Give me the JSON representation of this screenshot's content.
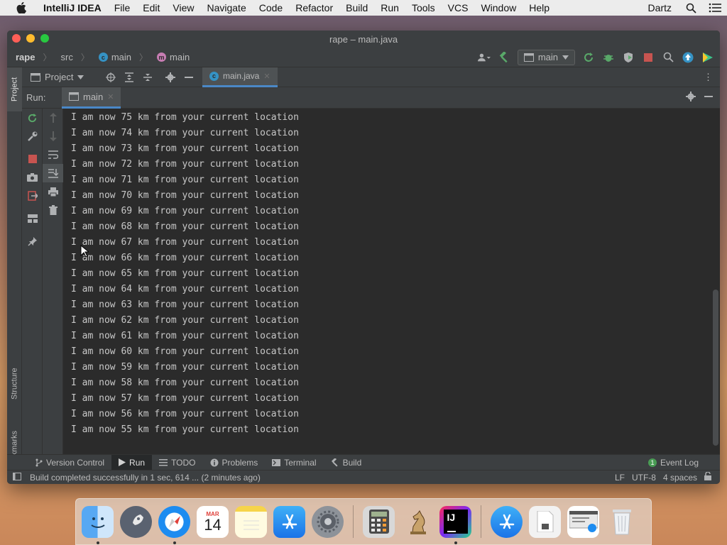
{
  "menubar": {
    "app_name": "IntelliJ IDEA",
    "items": [
      "File",
      "Edit",
      "View",
      "Navigate",
      "Code",
      "Refactor",
      "Build",
      "Run",
      "Tools",
      "VCS",
      "Window",
      "Help"
    ],
    "right_label": "Dartz"
  },
  "window": {
    "title": "rape – main.java"
  },
  "navbar": {
    "crumbs": [
      "rape",
      "src",
      "main",
      "main"
    ],
    "run_config": "main"
  },
  "project_toolbar": {
    "label": "Project",
    "editor_tab": "main.java"
  },
  "run_panel": {
    "title": "Run:",
    "tab": "main"
  },
  "left_strip": {
    "project": "Project",
    "structure": "Structure",
    "bookmarks": "Bookmarks"
  },
  "console": {
    "lines": [
      "I am now 75 km from your current location",
      "I am now 74 km from your current location",
      "I am now 73 km from your current location",
      "I am now 72 km from your current location",
      "I am now 71 km from your current location",
      "I am now 70 km from your current location",
      "I am now 69 km from your current location",
      "I am now 68 km from your current location",
      "I am now 67 km from your current location",
      "I am now 66 km from your current location",
      "I am now 65 km from your current location",
      "I am now 64 km from your current location",
      "I am now 63 km from your current location",
      "I am now 62 km from your current location",
      "I am now 61 km from your current location",
      "I am now 60 km from your current location",
      "I am now 59 km from your current location",
      "I am now 58 km from your current location",
      "I am now 57 km from your current location",
      "I am now 56 km from your current location",
      "I am now 55 km from your current location"
    ]
  },
  "bottom_tabs": {
    "version_control": "Version Control",
    "run": "Run",
    "todo": "TODO",
    "problems": "Problems",
    "terminal": "Terminal",
    "build": "Build",
    "event_log": "Event Log",
    "event_count": "1"
  },
  "statusbar": {
    "message": "Build completed successfully in 1 sec, 614 ... (2 minutes ago)",
    "line_sep": "LF",
    "encoding": "UTF-8",
    "indent": "4 spaces"
  },
  "dock": {
    "calendar_month": "MAR",
    "calendar_day": "14",
    "intellij_label": "IJ"
  },
  "colors": {
    "accent": "#4a88c7",
    "editor_bg": "#2b2b2b",
    "panel_bg": "#3c3f41",
    "run_green": "#499c54",
    "stop_red": "#c75450"
  }
}
